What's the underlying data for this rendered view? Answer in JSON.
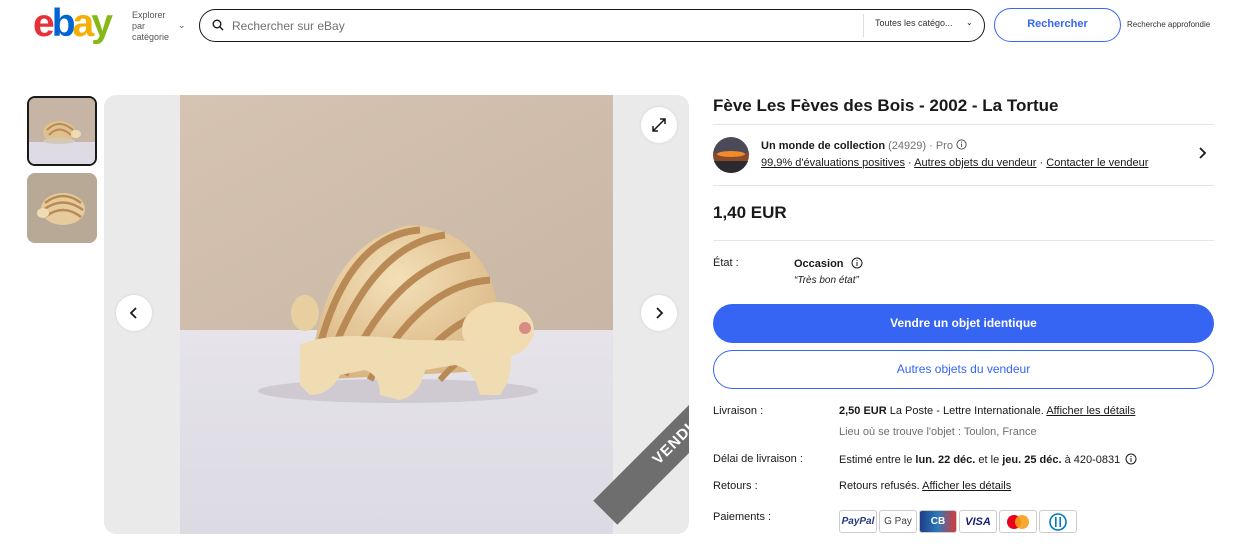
{
  "header": {
    "logo": [
      "e",
      "b",
      "a",
      "y"
    ],
    "explore_label": "Explorer par catégorie",
    "search_placeholder": "Rechercher sur eBay",
    "category_select": "Toutes les catégo...",
    "search_button": "Rechercher",
    "advanced_search": "Recherche approfondie"
  },
  "gallery": {
    "sold_ribbon": "VENDU"
  },
  "listing": {
    "title": "Fève Les Fèves des Bois - 2002 - La Tortue",
    "seller": {
      "name": "Un monde de collection",
      "feedback_count": "(24929)",
      "pro_label": "· Pro",
      "positive_feedback": "99,9% d'évaluations positives",
      "other_items": "Autres objets du vendeur",
      "contact": "Contacter le vendeur"
    },
    "price": "1,40 EUR",
    "condition_label": "État :",
    "condition_value": "Occasion",
    "condition_note": "“Très bon état”",
    "sell_button": "Vendre un objet identique",
    "other_items_button": "Autres objets du vendeur",
    "shipping_label": "Livraison :",
    "shipping_price": "2,50 EUR",
    "shipping_method": " La Poste - Lettre Internationale. ",
    "shipping_details_link": "Afficher les détails",
    "item_location": "Lieu où se trouve l'objet : Toulon, France",
    "delivery_label": "Délai de livraison :",
    "delivery_prefix": "Estimé entre le ",
    "delivery_from": "lun. 22 déc.",
    "delivery_mid": " et le ",
    "delivery_to": "jeu. 25 déc.",
    "delivery_suffix": " à 420-0831",
    "returns_label": "Retours :",
    "returns_value": "Retours refusés. ",
    "returns_link": "Afficher les détails",
    "payments_label": "Paiements :",
    "payments": [
      "PayPal",
      "G Pay",
      "CB",
      "VISA",
      "Mastercard",
      "Diners"
    ]
  }
}
